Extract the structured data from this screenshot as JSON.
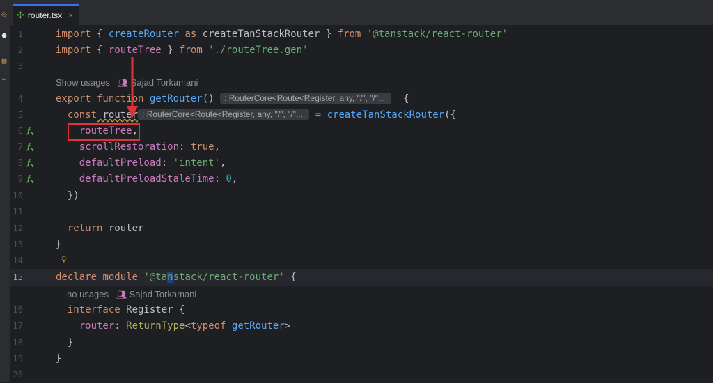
{
  "tab": {
    "icon": "tanstack-file-icon",
    "label": "router.tsx",
    "close": "×"
  },
  "activity": {
    "icons": [
      "git-icon",
      "github-icon",
      "structure-icon",
      "more-icon"
    ]
  },
  "lines": [
    {
      "n": "1"
    },
    {
      "n": "2"
    },
    {
      "n": "3"
    },
    {
      "n": "4"
    },
    {
      "n": "5"
    },
    {
      "n": "6"
    },
    {
      "n": "7"
    },
    {
      "n": "8"
    },
    {
      "n": "9"
    },
    {
      "n": "10"
    },
    {
      "n": "11"
    },
    {
      "n": "12"
    },
    {
      "n": "13"
    },
    {
      "n": "14"
    },
    {
      "n": "15"
    },
    {
      "n": "16"
    },
    {
      "n": "17"
    },
    {
      "n": "18"
    },
    {
      "n": "19"
    },
    {
      "n": "20"
    }
  ],
  "code": {
    "l1": {
      "import": "import",
      "ob": " { ",
      "createRouter": "createRouter",
      "as": " as ",
      "alias": "createTanStackRouter",
      "cb": " } ",
      "from": "from",
      "src": " '@tanstack/react-router'"
    },
    "l2": {
      "import": "import",
      "ob": " { ",
      "routeTree": "routeTree",
      "cb": " } ",
      "from": "from",
      "src": " './routeTree.gen'"
    },
    "lens1": {
      "usages": "Show usages",
      "author": "Sajad Torkamani"
    },
    "l4": {
      "export": "export",
      "function": " function ",
      "name": "getRouter",
      "parens": "()",
      "hint": ": RouterCore<Route<Register, any, \"/\", \"/\",...",
      "brace": "{"
    },
    "l5": {
      "const": "const",
      "name": " router",
      "hint": ": RouterCore<Route<Register, any, \"/\", \"/\",...",
      "eq": " = ",
      "call": "createTanStackRouter",
      "open": "({"
    },
    "l6": {
      "prop": "routeTree",
      "comma": ","
    },
    "l7": {
      "prop": "scrollRestoration",
      "colon": ": ",
      "value": "true",
      "comma": ","
    },
    "l8": {
      "prop": "defaultPreload",
      "colon": ": ",
      "value": "'intent'",
      "comma": ","
    },
    "l9": {
      "prop": "defaultPreloadStaleTime",
      "colon": ": ",
      "value": "0",
      "comma": ","
    },
    "l10": {
      "close": "})"
    },
    "l12": {
      "return": "return",
      "name": " router"
    },
    "l13": {
      "close": "}"
    },
    "l15": {
      "declare": "declare",
      "module": " module ",
      "s1": "'@ta",
      "s2": "n",
      "s3": "stack/react-router'",
      "brace": " {"
    },
    "lens2": {
      "usages": "no usages",
      "author": "Sajad Torkamani"
    },
    "l16": {
      "interface": "interface",
      "name": " Register",
      "brace": " {"
    },
    "l17": {
      "prop": "router",
      "colon": ": ",
      "type": "ReturnType",
      "lt": "<",
      "typeof": "typeof",
      "fn": " getRouter",
      "gt": ">"
    },
    "l18": {
      "close": "}"
    },
    "l19": {
      "close": "}"
    }
  },
  "gutter_icon_text": "f",
  "colors": {
    "keyword": "#cf8e6d",
    "function": "#56a8f5",
    "string": "#6aab73",
    "variable": "#c77dbb",
    "number": "#2aacb8",
    "annotation": "#e03238"
  }
}
